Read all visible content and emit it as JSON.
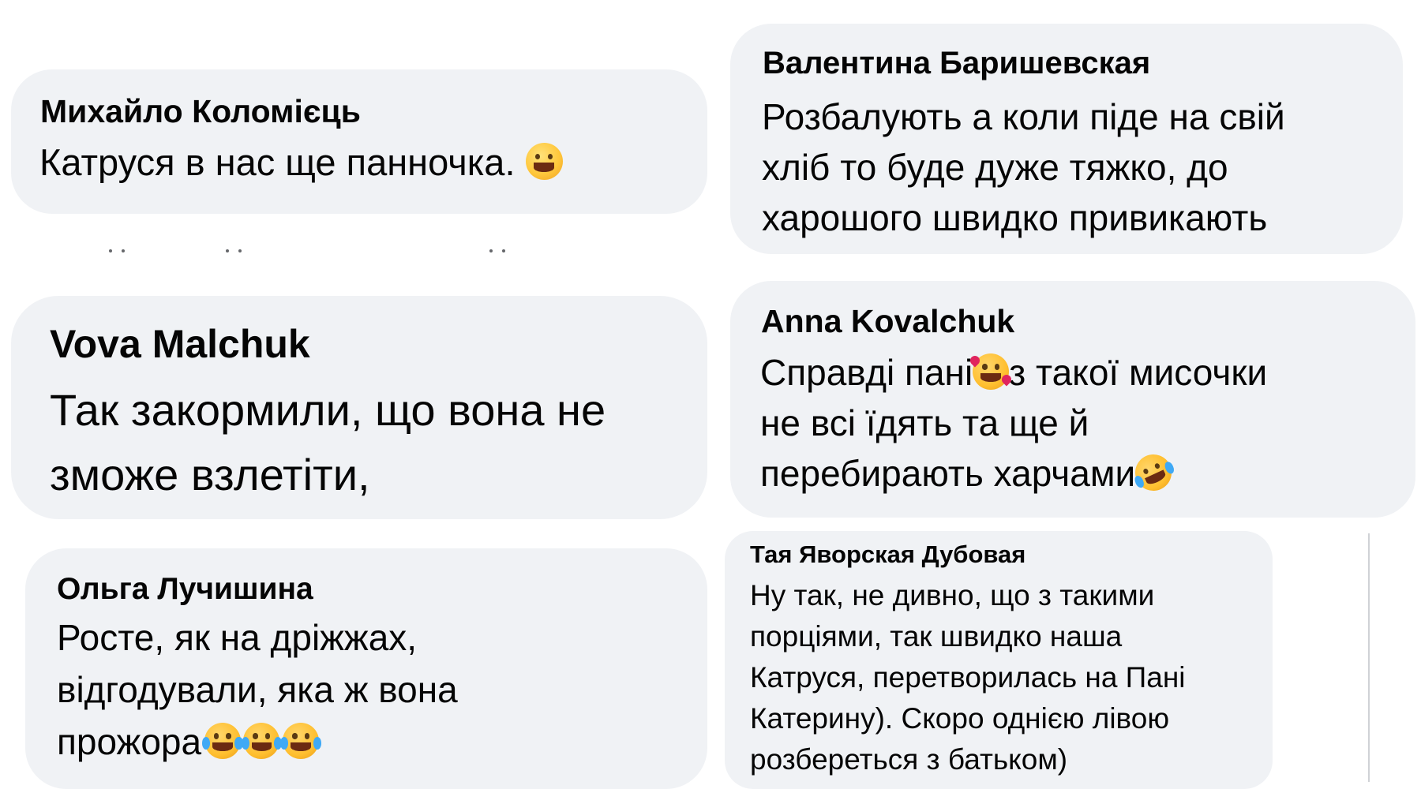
{
  "comments": [
    {
      "author": "Михайло Коломієць",
      "lines": [
        "Катруся в нас ще панночка."
      ],
      "emoji": "hugging-face-icon"
    },
    {
      "author": "Валентина Баришевская",
      "lines": [
        "Розбалують а коли піде на свій",
        "хліб то буде дуже тяжко, до",
        "харошого швидко привикають"
      ]
    },
    {
      "author": "Vova Malchuk",
      "lines": [
        "Так закормили, що вона не",
        "зможе взлетіти,"
      ]
    },
    {
      "author": "Anna Kovalchuk",
      "line1_before": "Справді пані",
      "line1_after": "з такої мисочки",
      "line2": "не всі їдять та ще й",
      "line3": "перебирають харчами",
      "emoji_hearts": "smiling-face-with-hearts-icon",
      "emoji_rofl": "rolling-on-floor-laughing-icon"
    },
    {
      "author": "Ольга Лучишина",
      "lines": [
        "Росте, як на дріжжах,",
        "відгодували, яка ж вона",
        "прожора"
      ],
      "emoji": "face-with-tears-of-joy-icon"
    },
    {
      "author": "Тая Яворская Дубовая",
      "lines": [
        "Ну так, не дивно, що з такими",
        "порціями, так швидко наша",
        "Катруся, перетворилась на Пані",
        "Катерину). Скоро однією лівою",
        "розбереться з батьком)"
      ]
    }
  ],
  "colors": {
    "bubble_bg": "#f0f2f5",
    "text": "#050505",
    "secondary": "#65676b"
  }
}
